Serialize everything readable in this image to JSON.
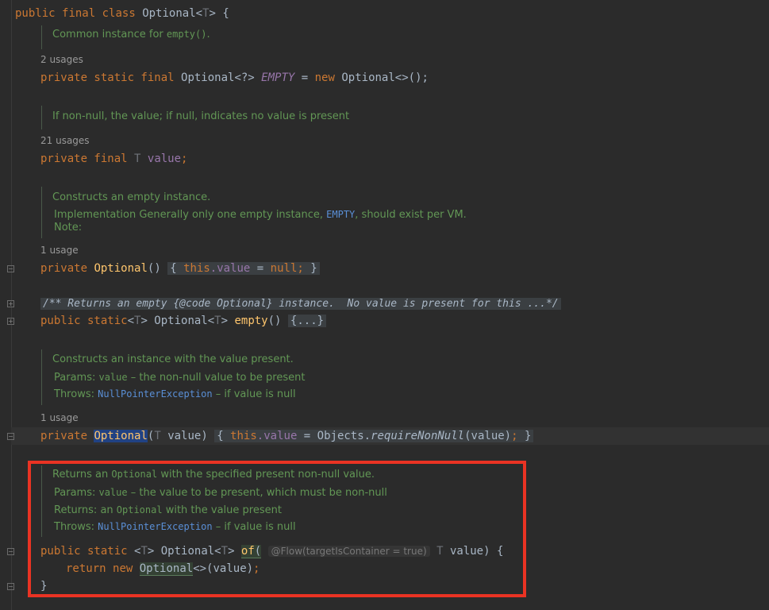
{
  "code": {
    "class_decl": {
      "kw1": "public",
      "kw2": "final",
      "kw3": "class",
      "name": "Optional<",
      "tparam": "T",
      "rest": "> {"
    },
    "doc_empty": {
      "text": "Common instance for ",
      "code": "empty()",
      "end": "."
    },
    "usages_empty": "2 usages",
    "empty_field": {
      "kw": "private static final",
      "type": "Optional<?>",
      "name": "EMPTY",
      "eq": " = ",
      "newkw": "new",
      "rest": " Optional<>();"
    },
    "doc_value": "If non-null, the value; if null, indicates no value is present",
    "usages_value": "21 usages",
    "value_field": {
      "kw": "private final",
      "tparam": "T",
      "name": "value",
      "semi": ";"
    },
    "doc_ctor": {
      "line1": "Constructs an empty instance.",
      "line2_pre": "Implementation Generally only one empty instance, ",
      "line2_link": "EMPTY",
      "line2_post": ", should exist per VM.",
      "line3": "Note:"
    },
    "usages_ctor": "1 usage",
    "ctor_empty": {
      "kw": "private",
      "name": "Optional",
      "parens": "()",
      "body_open": "{",
      "this_kw": "this",
      "dot_value": ".value",
      "assign": " = ",
      "null_kw": "null",
      "semi": ";",
      "body_close": "}"
    },
    "collapsed_comment": "/** Returns an empty {@code Optional} instance.  No value is present for this ...*/",
    "empty_method": {
      "kw": "public static",
      "lt": "<",
      "tparam": "T",
      "gt": "> Optional<",
      "tparam2": "T",
      "gt2": "> ",
      "name": "empty",
      "parens": "() ",
      "collapsed": "{...}"
    },
    "doc_ctor_value": {
      "line1": "Constructs an instance with the value present.",
      "params_label": "Params: ",
      "params_code": "value",
      "params_text": " – the non-null value to be present",
      "throws_label": "Throws: ",
      "throws_link": "NullPointerException",
      "throws_text": " – if value is null"
    },
    "usages_ctor_value": "1 usage",
    "ctor_value": {
      "kw": "private",
      "name": "Optional",
      "open": "(",
      "tparam": "T",
      "param": " value) ",
      "body_open": "{",
      "this_kw": "this",
      "dot_value": ".value",
      "assign": " = Objects.",
      "call": "requireNonNull",
      "args": "(value)",
      "semi": ";",
      "body_close": "}"
    },
    "doc_of": {
      "line1_pre": "Returns an ",
      "line1_code": "Optional",
      "line1_post": " with the specified present non-null value.",
      "params_label": "Params: ",
      "params_code": "value",
      "params_text": " – the value to be present, which must be non-null",
      "returns_label": "Returns: ",
      "returns_pre": "an ",
      "returns_code": "Optional",
      "returns_post": " with the value present",
      "throws_label": "Throws: ",
      "throws_link": "NullPointerException",
      "throws_text": " – if value is null"
    },
    "of_method": {
      "kw": "public static",
      "tp_open": "<",
      "tparam": "T",
      "tp_close": ">",
      "ret": " Optional<",
      "tparam2": "T",
      "ret_close": "> ",
      "name": "of",
      "open": "(",
      "hint": "@Flow(targetIsContainer = true)",
      "ptype": "T",
      "pname": " value) {"
    },
    "of_body": {
      "return_kw": "return",
      "new_kw": "new",
      "cls": "Optional",
      "rest": "<>(value)",
      "semi": ";"
    },
    "close_brace": "}"
  }
}
